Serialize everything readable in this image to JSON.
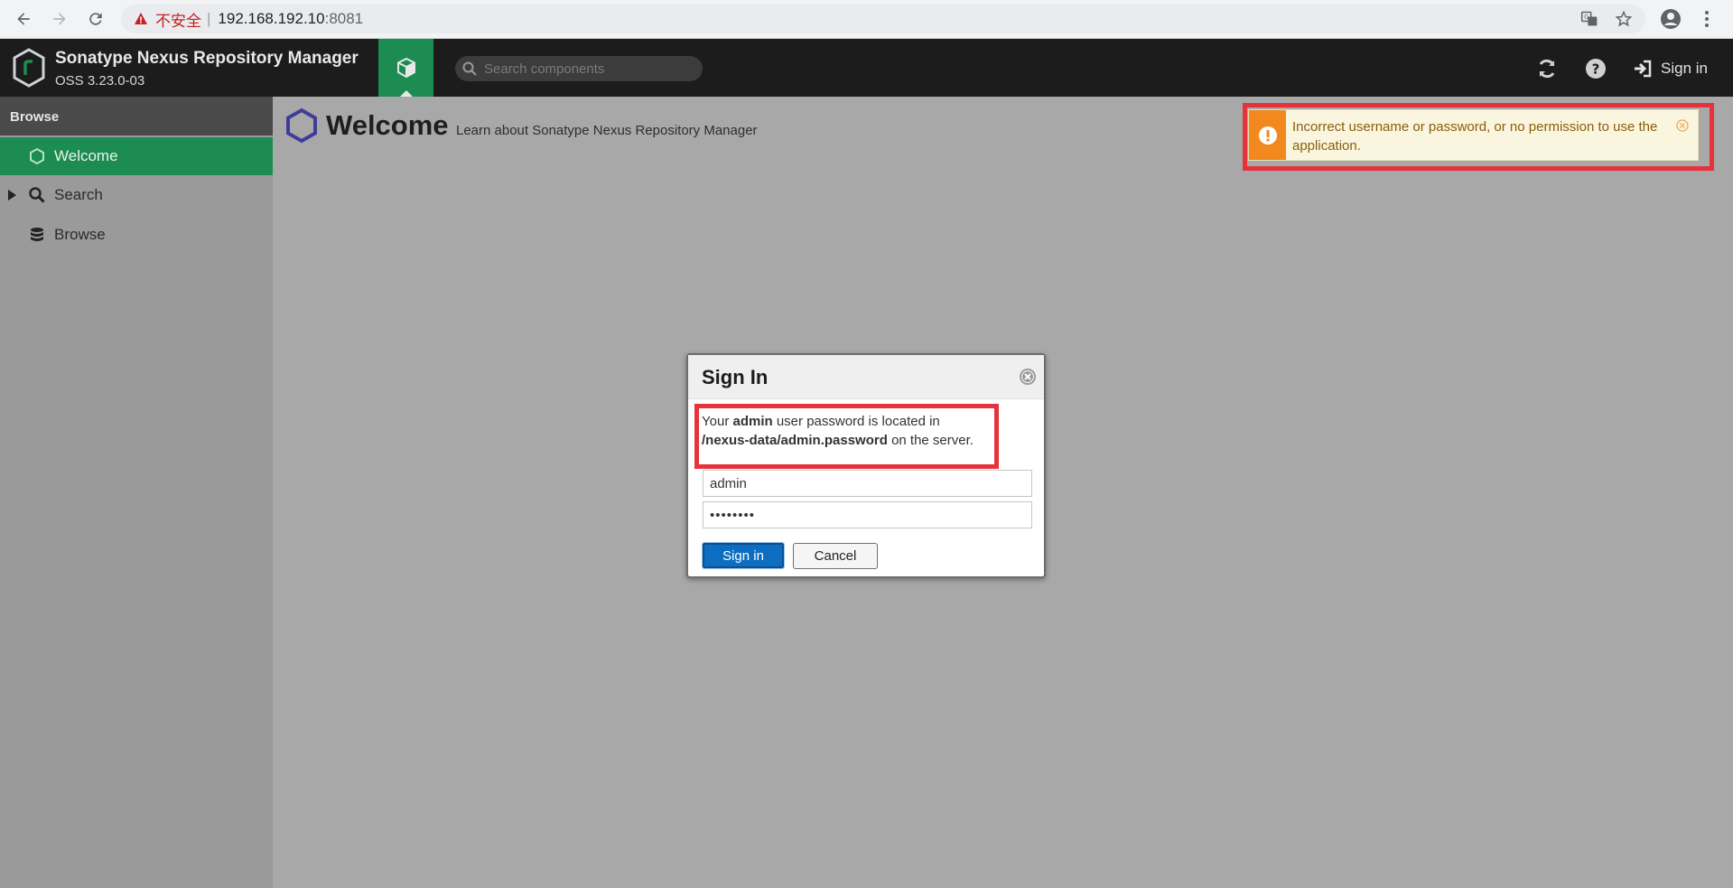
{
  "browser": {
    "insecure_label": "不安全",
    "separator": "|",
    "url_host": "192.168.192.10",
    "url_port": ":8081"
  },
  "header": {
    "product_name": "Sonatype Nexus Repository Manager",
    "version": "OSS 3.23.0-03",
    "search_placeholder": "Search components",
    "signin_label": "Sign in"
  },
  "sidebar": {
    "heading": "Browse",
    "items": [
      {
        "label": "Welcome",
        "icon": "hexagon-icon",
        "active": true
      },
      {
        "label": "Search",
        "icon": "search-icon",
        "active": false
      },
      {
        "label": "Browse",
        "icon": "database-icon",
        "active": false
      }
    ]
  },
  "main": {
    "title": "Welcome",
    "subtitle": "Learn about Sonatype Nexus Repository Manager"
  },
  "notification": {
    "message": "Incorrect username or password, or no permission to use the application.",
    "type": "error",
    "color": "#f2891e"
  },
  "dialog": {
    "title": "Sign In",
    "info_prefix": "Your",
    "info_user": "admin",
    "info_middle": "user password is located in",
    "info_path": "/nexus-data/admin.password",
    "info_suffix": "on the server.",
    "username_value": "admin",
    "password_value": "••••••••",
    "signin_button": "Sign in",
    "cancel_button": "Cancel"
  },
  "colors": {
    "brand_green": "#1d8c52",
    "primary_blue": "#0d6ec1",
    "highlight_red": "#e5323b"
  }
}
